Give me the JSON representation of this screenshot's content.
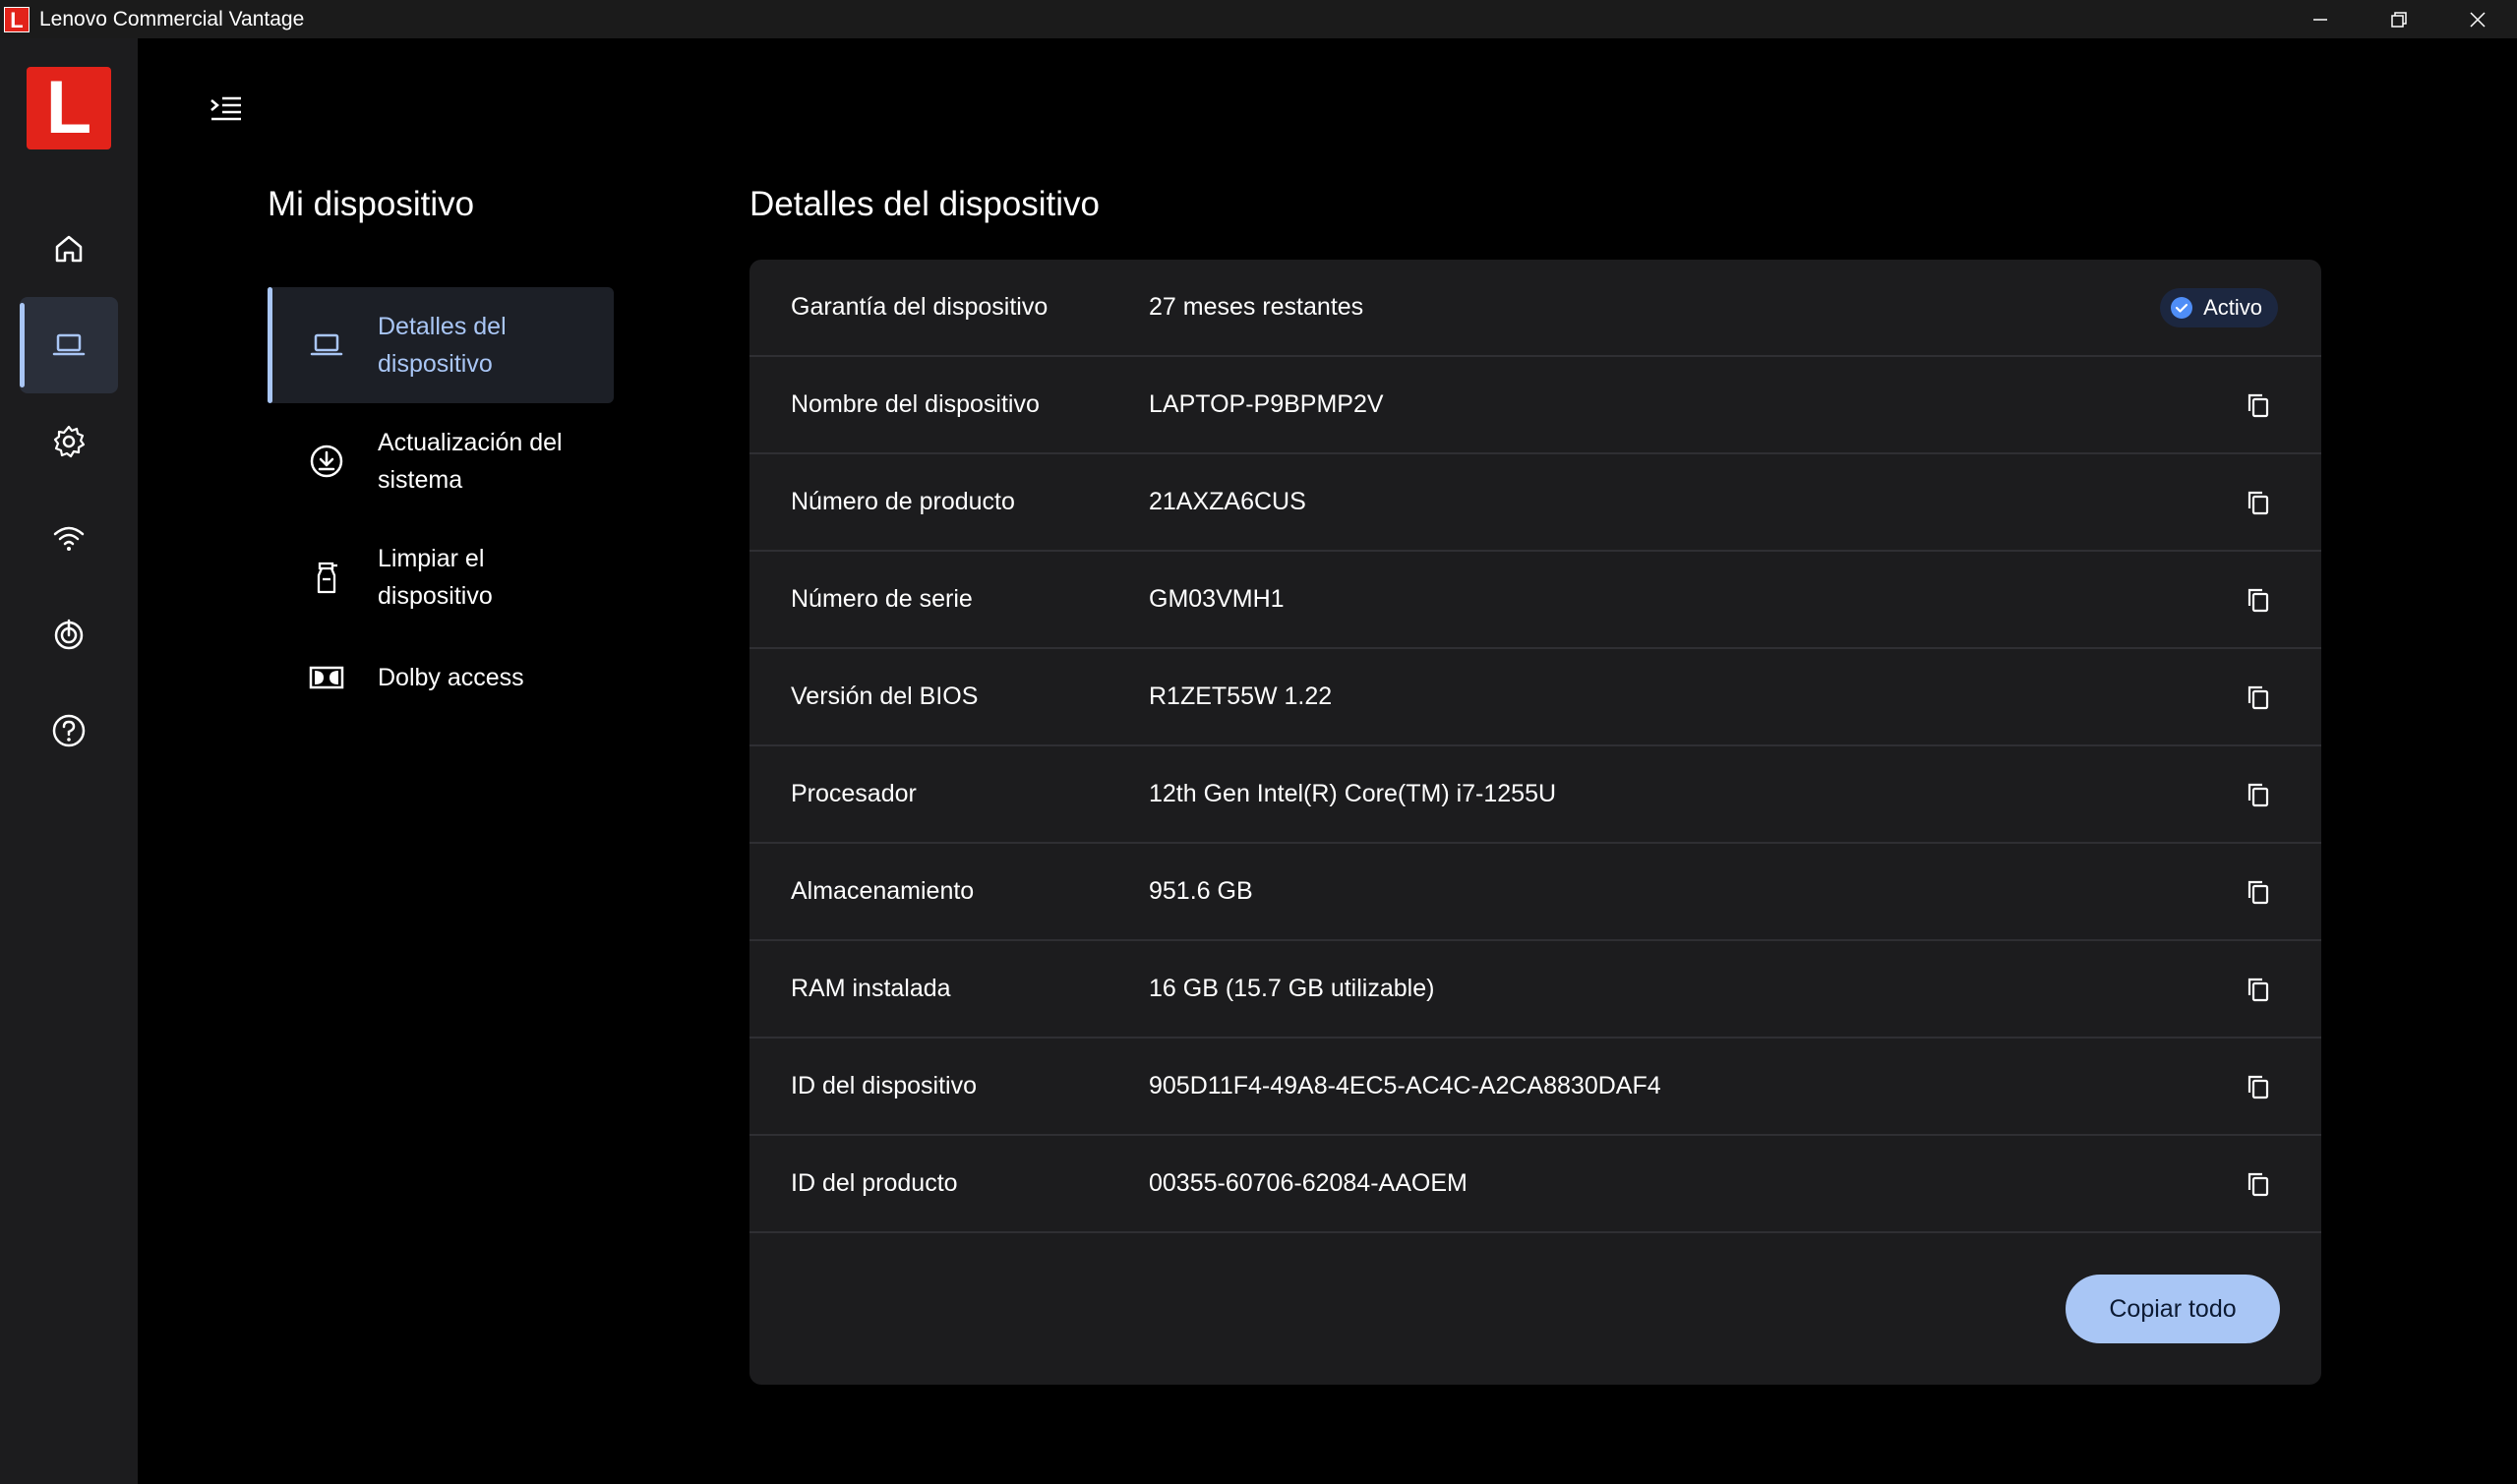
{
  "window": {
    "app_icon_letter": "L",
    "title": "Lenovo Commercial Vantage",
    "controls": [
      "minimize-icon",
      "restore-icon",
      "close-icon"
    ]
  },
  "rail": {
    "logo_letter": "L",
    "items": [
      {
        "icon": "home-icon",
        "active": false
      },
      {
        "icon": "laptop-icon",
        "active": true
      },
      {
        "icon": "gear-icon",
        "active": false
      },
      {
        "icon": "wifi-icon",
        "active": false
      },
      {
        "icon": "target-icon",
        "active": false
      },
      {
        "icon": "help-icon",
        "active": false
      }
    ]
  },
  "subnav": {
    "title": "Mi dispositivo",
    "items": [
      {
        "label": "Detalles del dispositivo",
        "icon": "laptop-icon",
        "active": true
      },
      {
        "label": "Actualización del sistema",
        "icon": "download-icon",
        "active": false
      },
      {
        "label": "Limpiar el dispositivo",
        "icon": "spray-bottle-icon",
        "active": false
      },
      {
        "label": "Dolby access",
        "icon": "dolby-icon",
        "active": false
      }
    ]
  },
  "main": {
    "title": "Detalles del dispositivo",
    "rows": [
      {
        "label": "Garantía del dispositivo",
        "value": "27 meses restantes",
        "badge": "Activo"
      },
      {
        "label": "Nombre del dispositivo",
        "value": "LAPTOP-P9BPMP2V"
      },
      {
        "label": "Número de producto",
        "value": "21AXZA6CUS"
      },
      {
        "label": "Número de serie",
        "value": "GM03VMH1"
      },
      {
        "label": "Versión del BIOS",
        "value": "R1ZET55W 1.22"
      },
      {
        "label": "Procesador",
        "value": "12th Gen Intel(R) Core(TM) i7-1255U"
      },
      {
        "label": "Almacenamiento",
        "value": "951.6 GB"
      },
      {
        "label": "RAM instalada",
        "value": "16 GB (15.7 GB utilizable)"
      },
      {
        "label": "ID del dispositivo",
        "value": "905D11F4-49A8-4EC5-AC4C-A2CA8830DAF4"
      },
      {
        "label": "ID del producto",
        "value": "00355-60706-62084-AAOEM"
      }
    ],
    "copy_all_label": "Copiar todo"
  },
  "colors": {
    "accent": "#a9c6f5",
    "brand_red": "#e2231a",
    "badge_check": "#4f8ef7"
  }
}
